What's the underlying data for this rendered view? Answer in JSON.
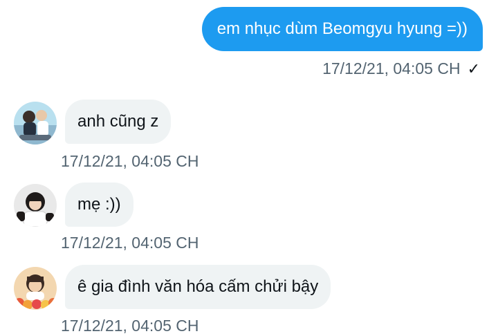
{
  "messages": [
    {
      "direction": "outgoing",
      "text": "em nhục dùm Beomgyu hyung =))",
      "timestamp": "17/12/21, 04:05 CH",
      "status_icon": "checkmark-icon"
    },
    {
      "direction": "incoming",
      "text": "anh cũng z",
      "timestamp": "17/12/21, 04:05 CH",
      "avatar_icon": "avatar-1"
    },
    {
      "direction": "incoming",
      "text": "mẹ :))",
      "timestamp": "17/12/21, 04:05 CH",
      "avatar_icon": "avatar-2"
    },
    {
      "direction": "incoming",
      "text": "ê gia đình văn hóa cấm chửi bậy",
      "timestamp": "17/12/21, 04:05 CH",
      "avatar_icon": "avatar-3"
    }
  ],
  "colors": {
    "outgoing_bubble": "#1d9bf0",
    "incoming_bubble": "#eff3f4",
    "timestamp": "#536471",
    "text": "#0f1419"
  }
}
